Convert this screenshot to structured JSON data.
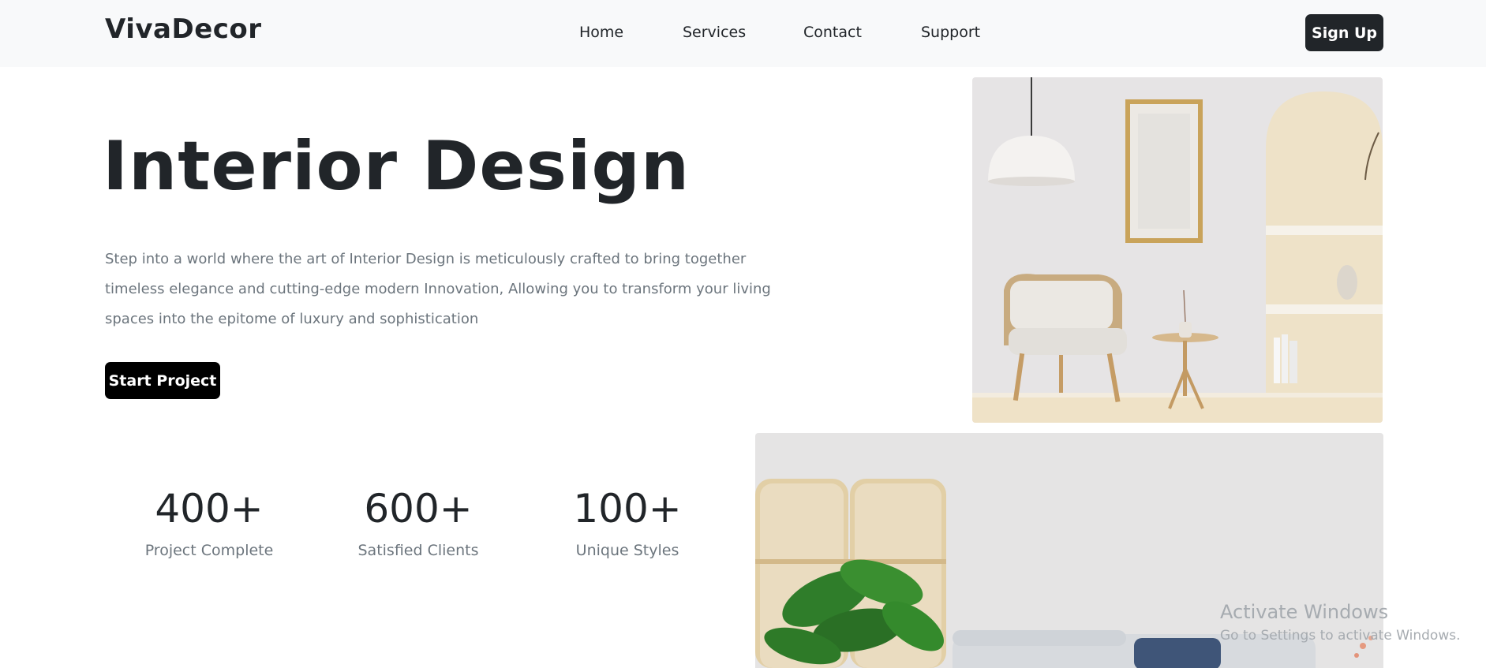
{
  "nav": {
    "brand": "VivaDecor",
    "links": [
      "Home",
      "Services",
      "Contact",
      "Support"
    ],
    "signup_label": "Sign Up"
  },
  "hero": {
    "title": "Interior Design",
    "description": "Step into a world where the art of Interior Design is meticulously crafted to bring together timeless elegance and cutting-edge modern Innovation, Allowing you to transform your living spaces into the epitome of luxury and sophistication",
    "cta_label": "Start Project"
  },
  "stats": [
    {
      "value": "400+",
      "label": "Project Complete"
    },
    {
      "value": "600+",
      "label": "Satisfied Clients"
    },
    {
      "value": "100+",
      "label": "Unique Styles"
    }
  ],
  "watermark": {
    "title": "Activate Windows",
    "subtitle": "Go to Settings to activate Windows."
  },
  "colors": {
    "navbar_bg": "#f8f9fa",
    "button_dark": "#212529",
    "cta_bg": "#000000",
    "muted_text": "#6c757d"
  }
}
